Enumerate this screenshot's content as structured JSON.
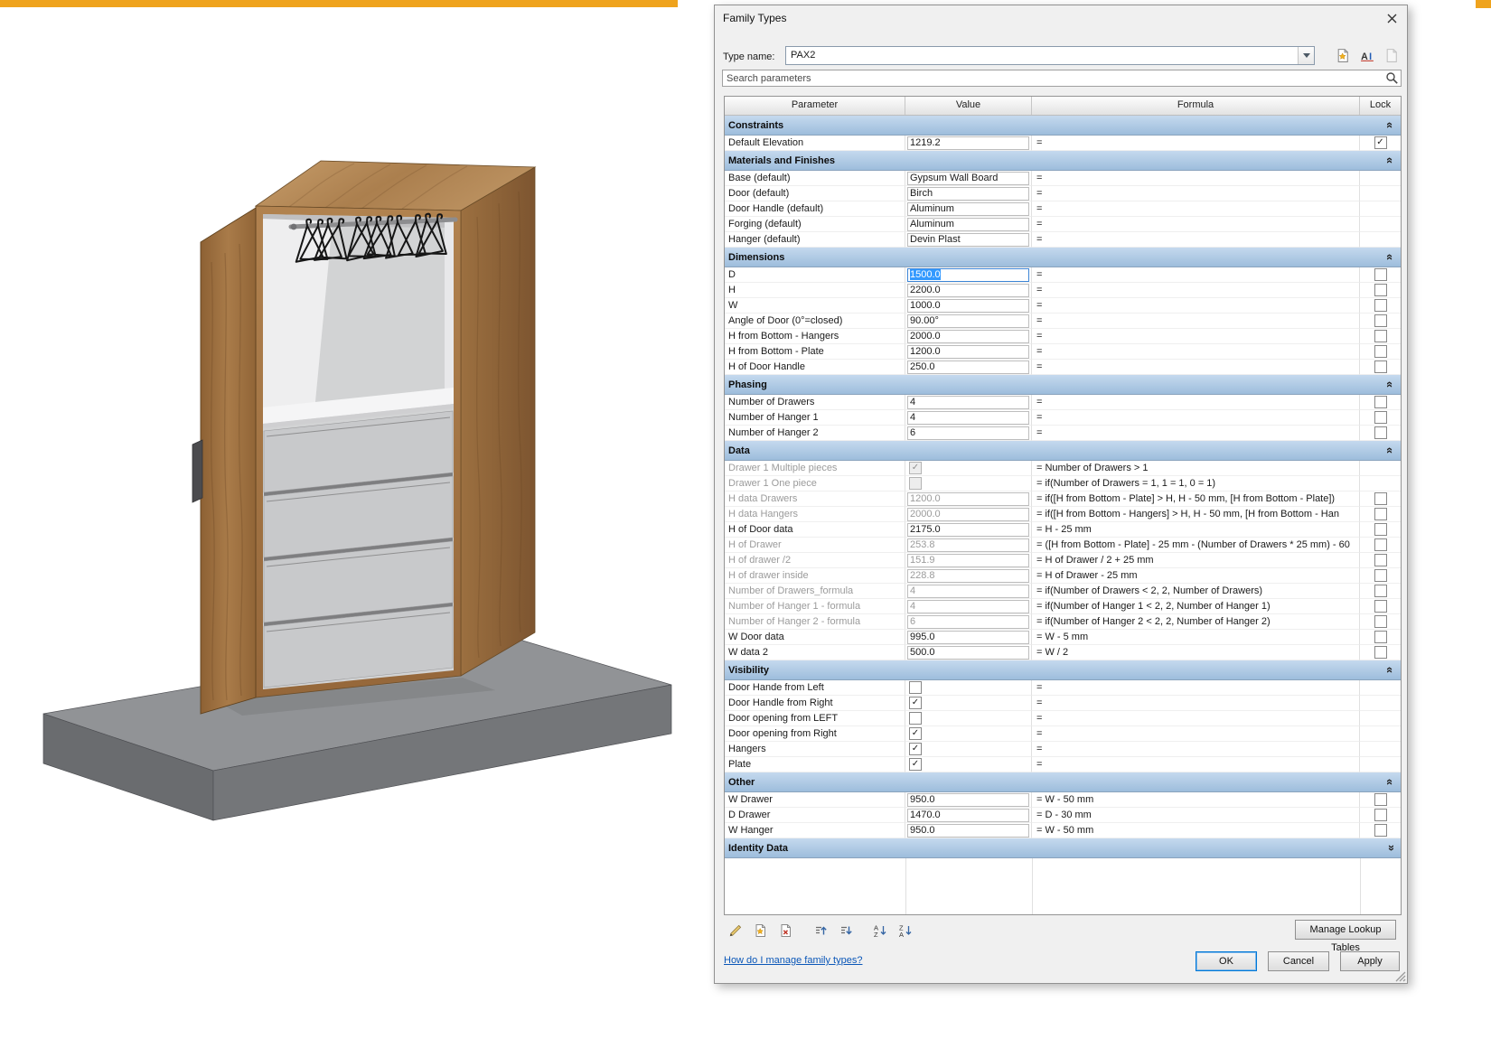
{
  "window": {
    "top_strip_color": "#efa31d"
  },
  "scene": {
    "description": "3D view of open wardrobe with hangers and drawers on gray pedestal",
    "wood_top": "#bf9463",
    "wood_front": "#a87a48",
    "wood_side": "#8a6038",
    "door_wood": "#9c7040",
    "base_top": "#919396",
    "base_front": "#747679",
    "base_left": "#6a6c6f"
  },
  "dialog": {
    "title": "Family Types",
    "type_name": {
      "label": "Type name:",
      "value": "PAX2",
      "buttons": [
        {
          "id": "new-type",
          "icon": "new-type-icon"
        },
        {
          "id": "rename-type",
          "icon": "rename-type-icon"
        },
        {
          "id": "delete-type",
          "icon": "delete-type-icon",
          "disabled": true
        }
      ]
    },
    "search": {
      "placeholder": "Search parameters"
    },
    "table": {
      "columns": [
        "Parameter",
        "Value",
        "Formula",
        "Lock"
      ],
      "sections": [
        {
          "name": "Constraints",
          "rows": [
            {
              "param": "Default Elevation",
              "value": "1219.2",
              "formula": "=",
              "lock": "checked"
            }
          ]
        },
        {
          "name": "Materials and Finishes",
          "rows": [
            {
              "param": "Base (default)",
              "value": "Gypsum Wall Board",
              "formula": "="
            },
            {
              "param": "Door (default)",
              "value": "Birch",
              "formula": "="
            },
            {
              "param": "Door Handle (default)",
              "value": "Aluminum",
              "formula": "="
            },
            {
              "param": "Forging (default)",
              "value": "Aluminum",
              "formula": "="
            },
            {
              "param": "Hanger (default)",
              "value": "Devin Plast",
              "formula": "="
            }
          ]
        },
        {
          "name": "Dimensions",
          "rows": [
            {
              "param": "D",
              "value": "1500.0",
              "formula": "=",
              "lock": "unchecked",
              "selected": true
            },
            {
              "param": "H",
              "value": "2200.0",
              "formula": "=",
              "lock": "unchecked"
            },
            {
              "param": "W",
              "value": "1000.0",
              "formula": "=",
              "lock": "unchecked"
            },
            {
              "param": "Angle of Door (0°=closed)",
              "value": "90.00°",
              "formula": "=",
              "lock": "unchecked"
            },
            {
              "param": "H from Bottom - Hangers",
              "value": "2000.0",
              "formula": "=",
              "lock": "unchecked"
            },
            {
              "param": "H from Bottom - Plate",
              "value": "1200.0",
              "formula": "=",
              "lock": "unchecked"
            },
            {
              "param": "H of Door Handle",
              "value": "250.0",
              "formula": "=",
              "lock": "unchecked"
            }
          ]
        },
        {
          "name": "Phasing",
          "rows": [
            {
              "param": "Number of Drawers",
              "value": "4",
              "formula": "=",
              "lock": "unchecked"
            },
            {
              "param": "Number of Hanger 1",
              "value": "4",
              "formula": "=",
              "lock": "unchecked"
            },
            {
              "param": "Number of Hanger 2",
              "value": "6",
              "formula": "=",
              "lock": "unchecked"
            }
          ]
        },
        {
          "name": "Data",
          "rows": [
            {
              "param": "Drawer 1 Multiple pieces",
              "value_checkbox": true,
              "checked": true,
              "formula": "= Number of Drawers > 1",
              "disabled": true
            },
            {
              "param": "Drawer 1 One piece",
              "value_checkbox": true,
              "checked": false,
              "formula": "= if(Number of Drawers = 1, 1 = 1, 0 = 1)",
              "disabled": true
            },
            {
              "param": "H data Drawers",
              "value": "1200.0",
              "formula": "= if([H from Bottom - Plate] > H, H - 50 mm, [H from Bottom - Plate])",
              "lock": "unchecked",
              "disabled": true
            },
            {
              "param": "H data Hangers",
              "value": "2000.0",
              "formula": "= if([H from Bottom - Hangers] > H, H - 50 mm, [H from Bottom - Han",
              "lock": "unchecked",
              "disabled": true
            },
            {
              "param": "H of Door data",
              "value": "2175.0",
              "formula": "= H - 25 mm",
              "lock": "unchecked"
            },
            {
              "param": "H of Drawer",
              "value": "253.8",
              "formula": "= ([H from Bottom - Plate] - 25 mm - (Number of Drawers * 25 mm) - 60",
              "lock": "unchecked",
              "disabled": true
            },
            {
              "param": "H of drawer /2",
              "value": "151.9",
              "formula": "= H of Drawer / 2 + 25 mm",
              "lock": "unchecked",
              "disabled": true
            },
            {
              "param": "H of drawer inside",
              "value": "228.8",
              "formula": "= H of Drawer - 25 mm",
              "lock": "unchecked",
              "disabled": true
            },
            {
              "param": "Number of Drawers_formula",
              "value": "4",
              "formula": "= if(Number of Drawers < 2, 2, Number of Drawers)",
              "lock": "unchecked",
              "disabled": true
            },
            {
              "param": "Number of Hanger 1 - formula",
              "value": "4",
              "formula": "= if(Number of Hanger 1 < 2, 2, Number of Hanger 1)",
              "lock": "unchecked",
              "disabled": true
            },
            {
              "param": "Number of Hanger 2 - formula",
              "value": "6",
              "formula": "= if(Number of Hanger 2 < 2, 2, Number of Hanger 2)",
              "lock": "unchecked",
              "disabled": true
            },
            {
              "param": "W Door data",
              "value": "995.0",
              "formula": "= W - 5 mm",
              "lock": "unchecked"
            },
            {
              "param": "W data 2",
              "value": "500.0",
              "formula": "= W / 2",
              "lock": "unchecked"
            }
          ]
        },
        {
          "name": "Visibility",
          "rows": [
            {
              "param": "Door Hande from Left",
              "value_checkbox": true,
              "checked": false,
              "formula": "="
            },
            {
              "param": "Door Handle from Right",
              "value_checkbox": true,
              "checked": true,
              "formula": "="
            },
            {
              "param": "Door opening from LEFT",
              "value_checkbox": true,
              "checked": false,
              "formula": "="
            },
            {
              "param": "Door opening from Right",
              "value_checkbox": true,
              "checked": true,
              "formula": "="
            },
            {
              "param": "Hangers",
              "value_checkbox": true,
              "checked": true,
              "formula": "="
            },
            {
              "param": "Plate",
              "value_checkbox": true,
              "checked": true,
              "formula": "="
            }
          ]
        },
        {
          "name": "Other",
          "rows": [
            {
              "param": "W Drawer",
              "value": "950.0",
              "formula": "= W - 50 mm",
              "lock": "unchecked"
            },
            {
              "param": "D Drawer",
              "value": "1470.0",
              "formula": "= D - 30 mm",
              "lock": "unchecked"
            },
            {
              "param": "W Hanger",
              "value": "950.0",
              "formula": "= W - 50 mm",
              "lock": "unchecked"
            }
          ]
        },
        {
          "name": "Identity Data",
          "collapsed": true,
          "rows": []
        }
      ]
    },
    "toolbar": {
      "manage_lookup_tables": "Manage Lookup Tables",
      "buttons": [
        {
          "id": "edit-parameter",
          "icon": "pencil-icon"
        },
        {
          "id": "new-parameter",
          "icon": "new-parameter-icon"
        },
        {
          "id": "delete-parameter",
          "icon": "delete-parameter-icon"
        },
        {
          "id": "move-parameter-up",
          "icon": "move-up-icon"
        },
        {
          "id": "move-parameter-down",
          "icon": "move-down-icon"
        },
        {
          "id": "sort-ascending",
          "icon": "sort-ascending-icon"
        },
        {
          "id": "sort-descending",
          "icon": "sort-descending-icon"
        }
      ]
    },
    "footer": {
      "help_link": "How do I manage family types?",
      "ok": "OK",
      "cancel": "Cancel",
      "apply": "Apply"
    },
    "colors": {
      "section_header": "#aec9e6",
      "selection": "#3399ff"
    }
  }
}
